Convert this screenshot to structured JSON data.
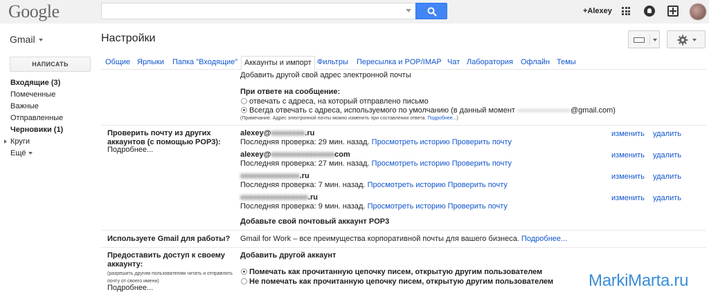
{
  "header": {
    "logo": "Google",
    "search": {
      "value": "",
      "placeholder": ""
    },
    "user_link": "+Alexey",
    "icons": [
      "apps-icon",
      "notifications-icon",
      "share-icon",
      "avatar"
    ]
  },
  "toolbar": {
    "app_name": "Gmail",
    "page_title": "Настройки",
    "icons": [
      "keyboard-icon",
      "gear-icon"
    ]
  },
  "sidebar": {
    "compose_label": "НАПИСАТЬ",
    "items": [
      {
        "label": "Входящие (3)",
        "bold": true
      },
      {
        "label": "Помеченные",
        "bold": false
      },
      {
        "label": "Важные",
        "bold": false
      },
      {
        "label": "Отправленные",
        "bold": false
      },
      {
        "label": "Черновики (1)",
        "bold": true
      },
      {
        "label": "Круги",
        "bold": false
      },
      {
        "label": "Ещё",
        "bold": false
      }
    ]
  },
  "tabs": [
    {
      "label": "Общие",
      "active": false
    },
    {
      "label": "Ярлыки",
      "active": false
    },
    {
      "label": "Папка \"Входящие\"",
      "active": false
    },
    {
      "label": "Аккаунты и импорт",
      "active": true
    },
    {
      "label": "Фильтры",
      "active": false
    },
    {
      "label": "Пересылка и POP/IMAP",
      "active": false
    },
    {
      "label": "Чат",
      "active": false
    },
    {
      "label": "Лаборатория",
      "active": false
    },
    {
      "label": "Офлайн",
      "active": false
    },
    {
      "label": "Темы",
      "active": false
    }
  ],
  "send_as": {
    "add_link": "Добавить другой свой адрес электронной почты",
    "reply_heading": "При ответе на сообщение:",
    "reply_option_1": "отвечать с адреса, на который отправлено письмо",
    "reply_option_2_prefix": "Всегда отвечать с адреса, используемого по умолчанию (в данный момент",
    "reply_option_2_blurred": "———————",
    "reply_option_2_suffix": "@gmail.com)",
    "note_text": "(Примечание. Адрес электронной почты можно изменить при составлении ответа.",
    "note_link": "Подробнее...",
    "note_close": ")"
  },
  "pop3": {
    "label_line1": "Проверить почту из других",
    "label_line2": "аккаунтов (с помощью POP3):",
    "more_link": "Подробнее...",
    "accounts": [
      {
        "name_visible": "alexey@",
        "name_blurred": "xxxxxxxx",
        "name_suffix": ".ru",
        "status": "Последняя проверка: 29 мин. назад.",
        "history_link": "Просмотреть историю",
        "check_link": "Проверить почту",
        "edit_link": "изменить",
        "delete_link": "удалить"
      },
      {
        "name_visible": "alexey@",
        "name_blurred": "xxxxxxxxxxxxxxx",
        "name_suffix": "com",
        "status": "Последняя проверка: 27 мин. назад.",
        "history_link": "Просмотреть историю",
        "check_link": "Проверить почту",
        "edit_link": "изменить",
        "delete_link": "удалить"
      },
      {
        "name_visible": "",
        "name_blurred": "xxxxxxxxxxxxxx",
        "name_suffix": ".ru",
        "status": "Последняя проверка: 7 мин. назад.",
        "history_link": "Просмотреть историю",
        "check_link": "Проверить почту",
        "edit_link": "изменить",
        "delete_link": "удалить"
      },
      {
        "name_visible": "",
        "name_blurred": "xxxxxxxxxxxxxxxx",
        "name_suffix": ".ru",
        "status": "Последняя проверка: 9 мин. назад.",
        "history_link": "Просмотреть историю",
        "check_link": "Проверить почту",
        "edit_link": "изменить",
        "delete_link": "удалить"
      }
    ],
    "add_link": "Добавьте свой почтовый аккаунт POP3"
  },
  "work": {
    "label": "Используете Gmail для работы?",
    "text": "Gmail for Work – все преимущества корпоративной почты для вашего бизнеса.",
    "more_link": "Подробнее..."
  },
  "grant": {
    "label_line1": "Предоставить доступ к своему",
    "label_line2": "аккаунту:",
    "note_line1": "(разрешить другим пользователям читать и отправлять",
    "note_line2": "почту от своего имени)",
    "more_link": "Подробнее...",
    "add_link": "Добавить другой аккаунт",
    "option_1": "Помечать как прочитанную цепочку писем, открытую другим пользователем",
    "option_2": "Не помечать как прочитанную цепочку писем, открытую другим пользователем"
  },
  "watermark": "MarkiMarta.ru"
}
